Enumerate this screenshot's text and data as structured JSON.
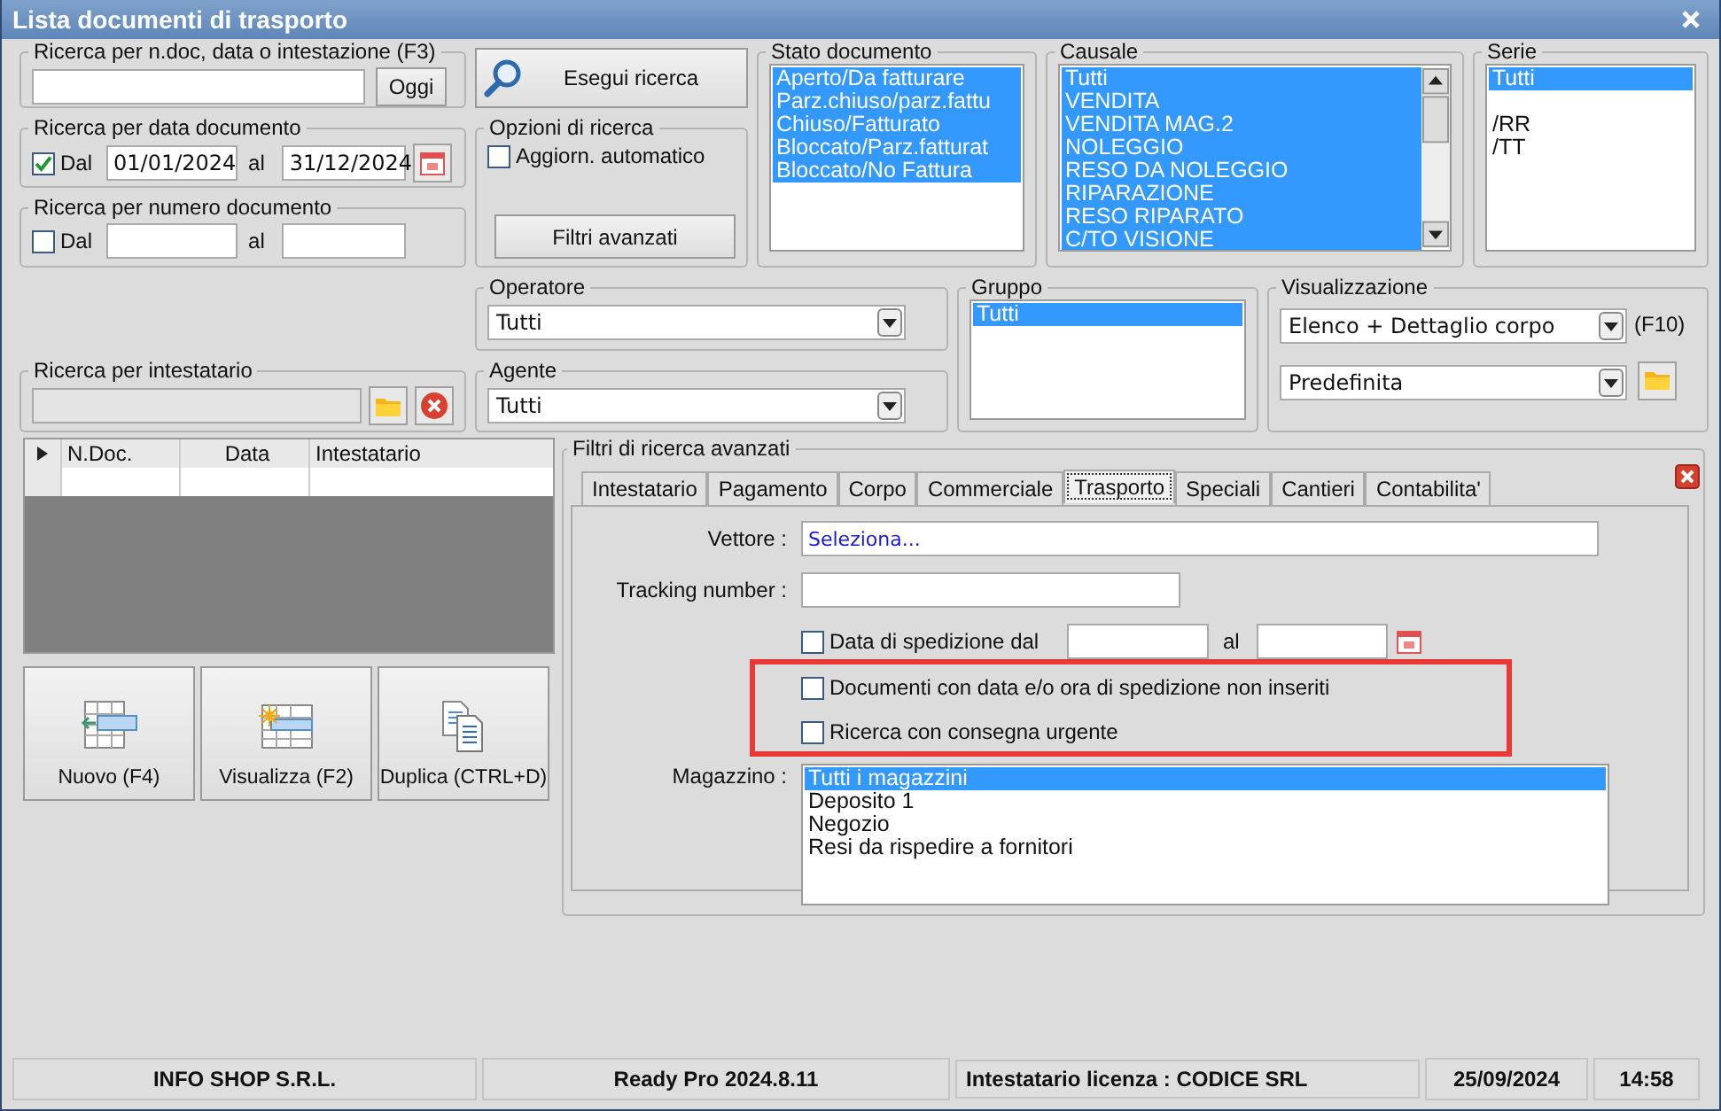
{
  "window": {
    "title": "Lista documenti di trasporto"
  },
  "text_search": {
    "label": "Ricerca per n.doc, data o intestazione (F3)",
    "button": "Oggi"
  },
  "date_search": {
    "label": "Ricerca per data documento",
    "checkbox": {
      "label": "Dal",
      "checked": true
    },
    "from": "01/01/2024",
    "to_label": "al",
    "to": "31/12/2024"
  },
  "number_search": {
    "label": "Ricerca per numero documento",
    "checkbox": {
      "label": "Dal",
      "checked": false
    },
    "to_label": "al"
  },
  "holder_search": {
    "label": "Ricerca per intestatario"
  },
  "search_button": "Esegui ricerca",
  "options": {
    "label": "Opzioni di ricerca",
    "auto_update": {
      "label": "Aggiorn. automatico",
      "checked": false
    },
    "advanced_button": "Filtri avanzati"
  },
  "operator": {
    "label": "Operatore",
    "value": "Tutti"
  },
  "agent": {
    "label": "Agente",
    "value": "Tutti"
  },
  "document_status": {
    "label": "Stato documento",
    "items": [
      {
        "text": "Aperto/Da fatturare",
        "selected": true
      },
      {
        "text": "Parz.chiuso/parz.fattu",
        "selected": true
      },
      {
        "text": "Chiuso/Fatturato",
        "selected": true
      },
      {
        "text": "Bloccato/Parz.fatturat",
        "selected": true
      },
      {
        "text": "Bloccato/No Fattura",
        "selected": true
      }
    ]
  },
  "causale": {
    "label": "Causale",
    "items": [
      {
        "text": "Tutti",
        "selected": true
      },
      {
        "text": "VENDITA",
        "selected": true
      },
      {
        "text": "VENDITA MAG.2",
        "selected": true
      },
      {
        "text": "NOLEGGIO",
        "selected": true
      },
      {
        "text": "RESO DA NOLEGGIO",
        "selected": true
      },
      {
        "text": "RIPARAZIONE",
        "selected": true
      },
      {
        "text": "RESO RIPARATO",
        "selected": true
      },
      {
        "text": "C/TO VISIONE",
        "selected": true
      }
    ]
  },
  "serie": {
    "label": "Serie",
    "items": [
      {
        "text": "Tutti",
        "selected": true
      },
      {
        "text": "/RR",
        "selected": false
      },
      {
        "text": "/TT",
        "selected": false
      }
    ]
  },
  "group": {
    "label": "Gruppo",
    "items": [
      {
        "text": "Tutti",
        "selected": true
      }
    ]
  },
  "view": {
    "label": "Visualizzazione",
    "mode": "Elenco + Dettaglio corpo",
    "shortcut": "(F10)",
    "layout": "Predefinita"
  },
  "table": {
    "columns": [
      "N.Doc.",
      "Data",
      "Intestatario"
    ]
  },
  "actions": [
    {
      "label": "Nuovo (F4)",
      "kind": "new"
    },
    {
      "label": "Visualizza (F2)",
      "kind": "view"
    },
    {
      "label": "Duplica (CTRL+D)",
      "kind": "duplicate"
    }
  ],
  "advanced": {
    "label": "Filtri di ricerca avanzati",
    "tabs": [
      {
        "label": "Intestatario",
        "selected": false
      },
      {
        "label": "Pagamento",
        "selected": false
      },
      {
        "label": "Corpo",
        "selected": false
      },
      {
        "label": "Commerciale",
        "selected": false
      },
      {
        "label": "Trasporto",
        "selected": true
      },
      {
        "label": "Speciali",
        "selected": false
      },
      {
        "label": "Cantieri",
        "selected": false
      },
      {
        "label": "Contabilita'",
        "selected": false
      }
    ],
    "carrier": {
      "label": "Vettore :",
      "value": "Seleziona..."
    },
    "tracking": {
      "label": "Tracking number :"
    },
    "ship_date": {
      "label": "Data di spedizione dal",
      "checked": false,
      "to_label": "al"
    },
    "checks": [
      {
        "label": "Documenti con data e/o ora di spedizione non inseriti",
        "checked": false
      },
      {
        "label": "Ricerca con consegna urgente",
        "checked": false
      }
    ],
    "warehouse": {
      "label": "Magazzino :",
      "items": [
        {
          "text": "Tutti i magazzini",
          "selected": true
        },
        {
          "text": "Deposito 1",
          "selected": false
        },
        {
          "text": "Negozio",
          "selected": false
        },
        {
          "text": "Resi da rispedire a fornitori",
          "selected": false
        }
      ]
    }
  },
  "status_bar": [
    "INFO SHOP S.R.L.",
    "Ready Pro 2024.8.11",
    "Intestatario licenza : CODICE SRL",
    "25/09/2024",
    "14:58"
  ]
}
